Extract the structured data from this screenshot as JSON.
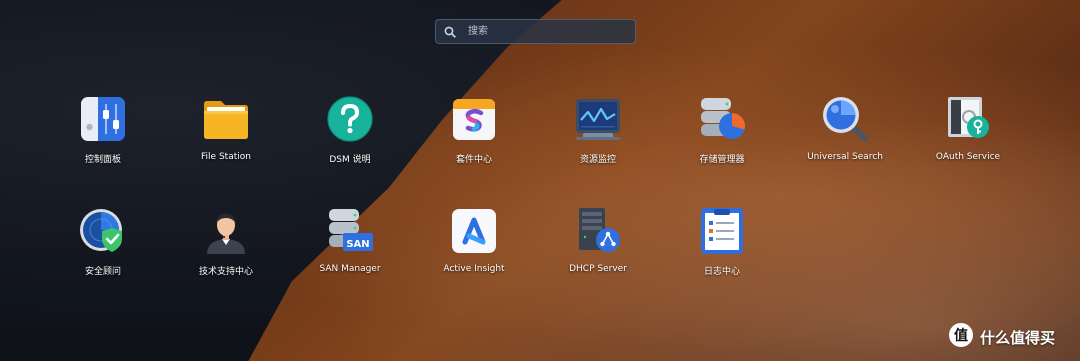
{
  "search": {
    "placeholder": "搜索"
  },
  "apps": [
    {
      "label": "控制面板",
      "icon": "control-panel-icon"
    },
    {
      "label": "File Station",
      "icon": "folder-icon"
    },
    {
      "label": "DSM 说明",
      "icon": "help-icon"
    },
    {
      "label": "套件中心",
      "icon": "package-center-icon"
    },
    {
      "label": "资源监控",
      "icon": "resource-monitor-icon"
    },
    {
      "label": "存储管理器",
      "icon": "storage-manager-icon"
    },
    {
      "label": "Universal Search",
      "icon": "universal-search-icon"
    },
    {
      "label": "OAuth Service",
      "icon": "oauth-service-icon"
    },
    {
      "label": "安全顾问",
      "icon": "security-advisor-icon"
    },
    {
      "label": "技术支持中心",
      "icon": "support-center-icon"
    },
    {
      "label": "SAN Manager",
      "icon": "san-manager-icon"
    },
    {
      "label": "Active Insight",
      "icon": "active-insight-icon"
    },
    {
      "label": "DHCP Server",
      "icon": "dhcp-server-icon"
    },
    {
      "label": "日志中心",
      "icon": "log-center-icon"
    }
  ],
  "watermark": {
    "text": "什么值得买",
    "icon": "smzdm-logo-icon"
  },
  "colors": {
    "search_bg": "#283444",
    "label_text": "#ffffff",
    "accent_blue": "#2f6fe0",
    "accent_teal": "#1fb7a0"
  }
}
